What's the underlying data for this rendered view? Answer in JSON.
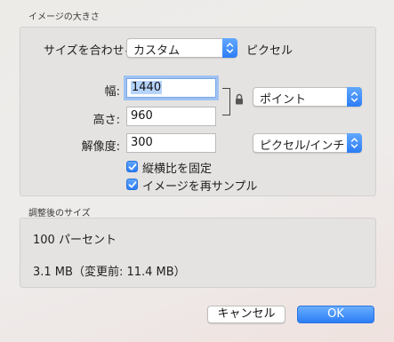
{
  "image_size": {
    "section_title": "イメージの大きさ",
    "fit_label": "サイズを合わせる:",
    "fit_value": "カスタム",
    "fit_unit": "ピクセル",
    "width_label": "幅:",
    "width_value": "1440",
    "height_label": "高さ:",
    "height_value": "960",
    "size_unit": "ポイント",
    "resolution_label": "解像度:",
    "resolution_value": "300",
    "resolution_unit": "ピクセル/インチ",
    "proportional_label": "縦横比を固定",
    "proportional_checked": true,
    "resample_label": "イメージを再サンプル",
    "resample_checked": true
  },
  "result": {
    "section_title": "調整後のサイズ",
    "percent_text": "100 パーセント",
    "size_text": "3.1 MB（変更前: 11.4 MB）"
  },
  "buttons": {
    "cancel": "キャンセル",
    "ok": "OK"
  },
  "colors": {
    "accent": "#2c7ef5",
    "panel": "#e5e3e1"
  }
}
